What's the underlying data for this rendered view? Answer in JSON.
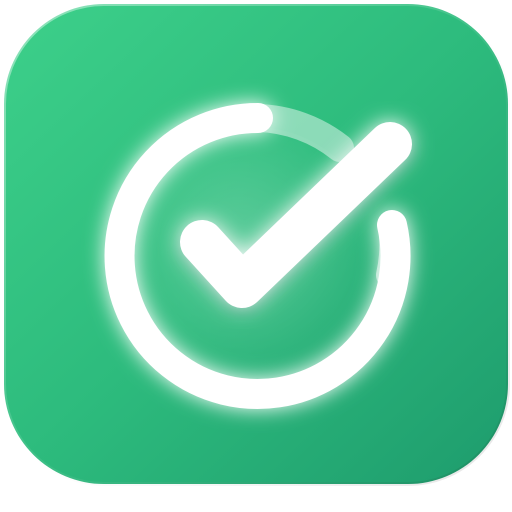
{
  "icon": {
    "name": "checkmark-in-circle",
    "colors": {
      "background_top": "#3DD08A",
      "background_mid": "#2DBB7D",
      "background_bottom": "#1E9C6D",
      "edge_highlight": "#7EE8B4",
      "symbol": "#FFFFFF"
    }
  }
}
